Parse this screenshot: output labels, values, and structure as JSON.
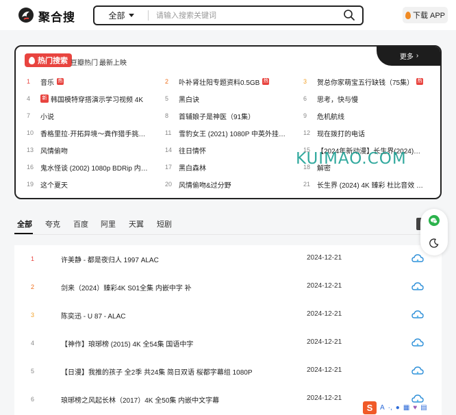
{
  "header": {
    "brand": "聚合搜",
    "category": "全部",
    "search_placeholder": "请输入搜索关键词",
    "download_app": "下载 APP"
  },
  "hot": {
    "badge": "热门搜索",
    "sub_tabs": [
      "豆瓣热门",
      "最新上映"
    ],
    "more": "更多",
    "hot_tag": "热",
    "new_tag": "新",
    "items": [
      {
        "num": "1",
        "text": "音乐",
        "tag": true
      },
      {
        "num": "2",
        "text": "卟补肾壮阳专题资料0.5GB",
        "tag": true
      },
      {
        "num": "3",
        "text": "贺总你家萌宝五行缺钱（75集）",
        "tag": true
      },
      {
        "num": "4",
        "text": "韩国模特穿搭演示学习视频 4K",
        "pre": true
      },
      {
        "num": "5",
        "text": "黑白诀"
      },
      {
        "num": "6",
        "text": "思考，快与慢"
      },
      {
        "num": "7",
        "text": "小说"
      },
      {
        "num": "8",
        "text": "首辅娘子是神医（91集）"
      },
      {
        "num": "9",
        "text": "危机航线"
      },
      {
        "num": "10",
        "text": "香格里拉·开拓异境～粪作猎手挑战神…"
      },
      {
        "num": "11",
        "text": "雪豹女王 (2021) 1080P 中英外挂字幕"
      },
      {
        "num": "12",
        "text": "现在拨打的电话"
      },
      {
        "num": "13",
        "text": "风情偷吻"
      },
      {
        "num": "14",
        "text": "往日情怀"
      },
      {
        "num": "15",
        "text": "【2024年新动漫】长生界(2024)【更…"
      },
      {
        "num": "16",
        "text": "鬼水怪谈 (2002) 1080p BDRip 内封简繁"
      },
      {
        "num": "17",
        "text": "黑白森林"
      },
      {
        "num": "18",
        "text": "解密"
      },
      {
        "num": "19",
        "text": "这个夏天"
      },
      {
        "num": "20",
        "text": "风情偷吻&过分野"
      },
      {
        "num": "21",
        "text": "长生界 (2024) 4K 臻彩 杜比音效 S01…"
      }
    ]
  },
  "watermark": "KUIMAO.COM",
  "tabs": [
    "全部",
    "夸克",
    "百度",
    "阿里",
    "天翼",
    "短剧"
  ],
  "results": [
    {
      "num": "1",
      "title": "许美静 - 都是夜归人 1997 ALAC",
      "date": "2024-12-21"
    },
    {
      "num": "2",
      "title": "剑来（2024）臻彩4K S01全集 内嵌中字 补",
      "date": "2024-12-21"
    },
    {
      "num": "3",
      "title": "陈奕迅 - U 87 - ALAC",
      "date": "2024-12-21"
    },
    {
      "num": "4",
      "title": "【神作】琅琊榜 (2015) 4K 全54集 国语中字",
      "date": "2024-12-21"
    },
    {
      "num": "5",
      "title": "【日漫】我推的孩子 全2季 共24集 简日双语 桜都字幕组 1080P",
      "date": "2024-12-21"
    },
    {
      "num": "6",
      "title": "琅琊榜之风起长林（2017）4K 全50集 内嵌中文字幕",
      "date": "2024-12-21"
    }
  ],
  "ime": {
    "logo": "S",
    "label": "A"
  }
}
